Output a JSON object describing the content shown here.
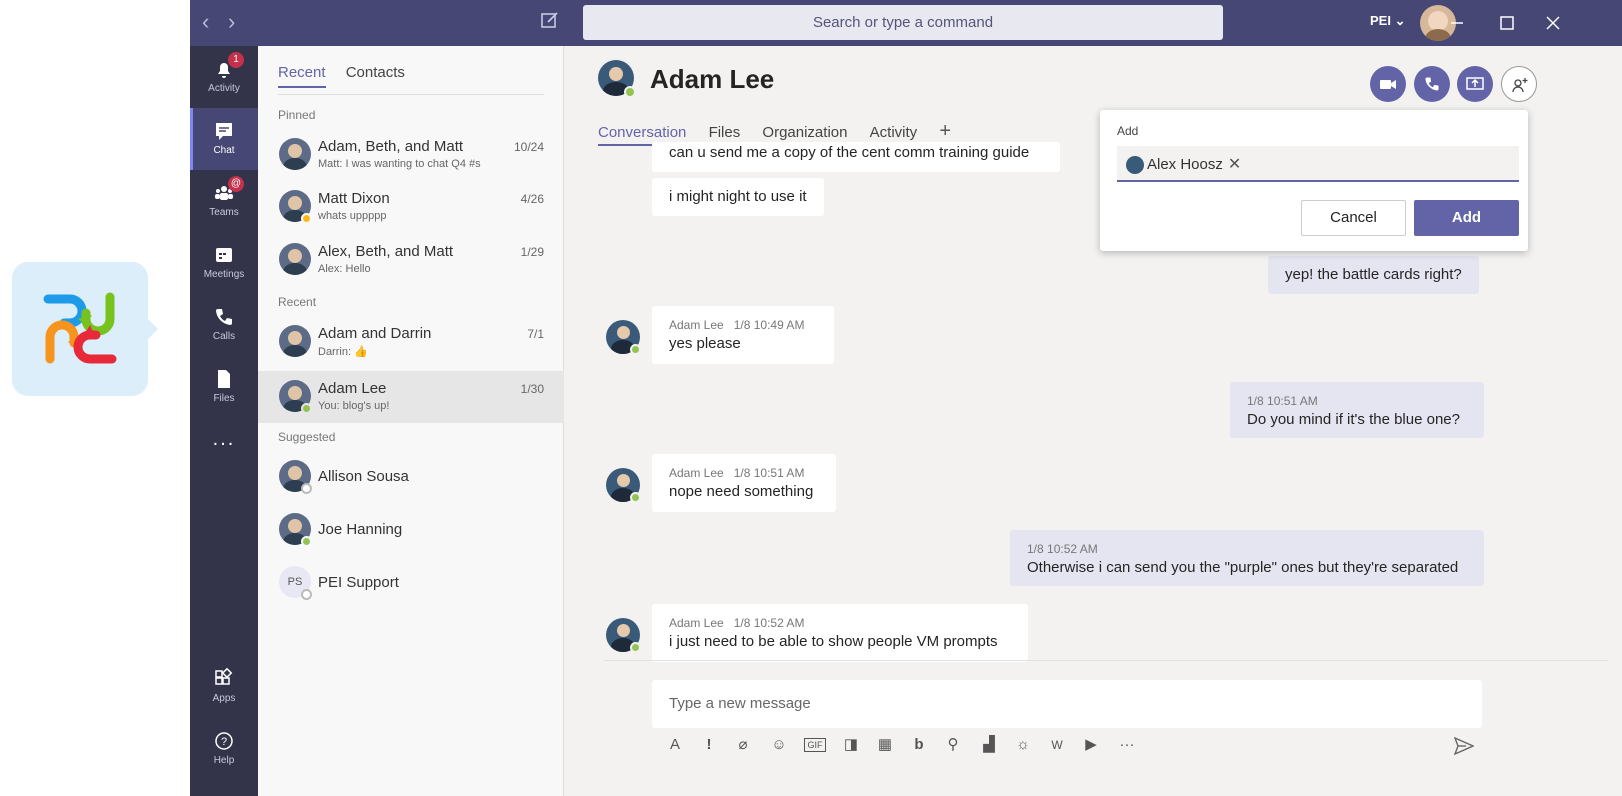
{
  "titlebar": {
    "search_placeholder": "Search or type a command",
    "org": "PEI ⌄"
  },
  "rail": {
    "items": [
      {
        "label": "Activity",
        "badge": "1"
      },
      {
        "label": "Chat"
      },
      {
        "label": "Teams",
        "badge": "@"
      },
      {
        "label": "Meetings"
      },
      {
        "label": "Calls"
      },
      {
        "label": "Files"
      },
      {
        "label": "..."
      },
      {
        "label": "Apps"
      },
      {
        "label": "Help"
      }
    ]
  },
  "chatlist": {
    "tabs": [
      "Recent",
      "Contacts"
    ],
    "sections": {
      "pinned": "Pinned",
      "recent": "Recent",
      "suggested": "Suggested"
    },
    "pinned": [
      {
        "name": "Adam, Beth, and Matt",
        "preview": "Matt: I was wanting to chat Q4 #s",
        "date": "10/24"
      },
      {
        "name": "Matt Dixon",
        "preview": "whats uppppp",
        "date": "4/26"
      },
      {
        "name": "Alex, Beth, and Matt",
        "preview": "Alex: Hello",
        "date": "1/29"
      }
    ],
    "recent": [
      {
        "name": "Adam and Darrin",
        "preview": "Darrin: 👍",
        "date": "7/1"
      },
      {
        "name": "Adam Lee",
        "preview": "You: blog's up!",
        "date": "1/30"
      }
    ],
    "suggested": [
      {
        "name": "Allison Sousa"
      },
      {
        "name": "Joe Hanning"
      },
      {
        "name": "PEI Support",
        "initials": "PS"
      }
    ]
  },
  "conversation": {
    "name": "Adam Lee",
    "tabs": [
      "Conversation",
      "Files",
      "Organization",
      "Activity",
      "+"
    ],
    "messages": [
      {
        "text": "can u send me a copy of the cent comm training guide"
      },
      {
        "text": "i might night to use it"
      },
      {
        "text": "yep! the battle cards right?"
      },
      {
        "sender": "Adam Lee",
        "time": "1/8 10:49 AM",
        "text": "yes please"
      },
      {
        "time": "1/8 10:51 AM",
        "text": "Do you mind if it's the blue one?"
      },
      {
        "sender": "Adam Lee",
        "time": "1/8 10:51 AM",
        "text": "nope need something"
      },
      {
        "time": "1/8 10:52 AM",
        "text": "Otherwise i can send you the \"purple\" ones but they're separated"
      },
      {
        "sender": "Adam Lee",
        "time": "1/8 10:52 AM",
        "text": "i just need to be able to show people VM prompts"
      }
    ],
    "compose_placeholder": "Type a new message"
  },
  "add_dialog": {
    "title": "Add",
    "chip": "Alex Hoosz",
    "cancel": "Cancel",
    "add": "Add"
  },
  "colors": {
    "brand": "#6264a7",
    "titlebar": "#464775",
    "rail": "#33344a",
    "online": "#92c353"
  }
}
